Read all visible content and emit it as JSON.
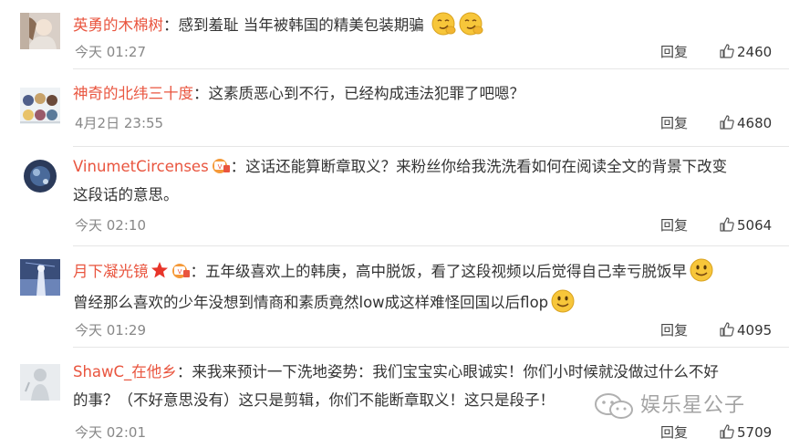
{
  "comments": [
    {
      "username": "英勇的木棉树",
      "text": "感到羞耻 当年被韩国的精美包装期骗",
      "time": "今天 01:27",
      "reply_label": "回复",
      "likes": "2460",
      "emoji": [
        "smirk-emoji",
        "smirk-emoji"
      ]
    },
    {
      "username": "神奇的北纬三十度",
      "text": "这素质恶心到不行，已经构成违法犯罪了吧嗯？",
      "time": "4月2日 23:55",
      "reply_label": "回复",
      "likes": "4680"
    },
    {
      "username": "VinumetCircenses",
      "text1": "这话还能算断章取义？来粉丝你给我洗洗看如何在阅读全文的背景下改变",
      "text2": "这段话的意思。",
      "time": "今天 02:10",
      "reply_label": "回复",
      "likes": "5064",
      "badges": [
        "vip-badge-icon"
      ]
    },
    {
      "username": "月下凝光镜",
      "text1": "五年级喜欢上的韩庚，高中脱饭，看了这段视频以后觉得自己幸亏脱饭早",
      "text2": "曾经那么喜欢的少年没想到情商和素质竟然low成这样难怪回国以后flop",
      "time": "今天 01:29",
      "reply_label": "回复",
      "likes": "4095",
      "badges": [
        "star-badge-icon",
        "vip-badge-icon"
      ],
      "emoji": [
        "smile-emoji",
        "smile-emoji"
      ]
    },
    {
      "username": "ShawC_在他乡",
      "text1": "来我来预计一下洗地姿势：我们宝宝实心眼诚实！你们小时候就没做过什么不好",
      "text2": "的事？（不好意思没有）这只是剪辑，你们不能断章取义！这只是段子！",
      "time": "今天 02:01",
      "reply_label": "回复",
      "likes": "5709"
    }
  ],
  "watermark": {
    "text": "娱乐星公子",
    "icon": "wechat-icon"
  },
  "colors": {
    "username": "#e9553f",
    "meta": "#888888",
    "divider": "#e6e6e6",
    "emoji_face": "#f7c63a"
  }
}
